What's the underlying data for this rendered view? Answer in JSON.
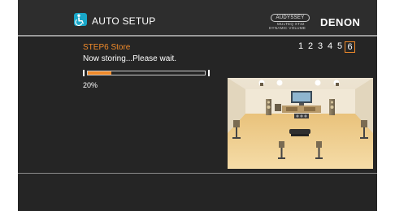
{
  "app": {
    "title": "AUTO SETUP",
    "icon": "accessibility-person-icon"
  },
  "branding": {
    "audyssey_badge": "AUDYSSEY",
    "audyssey_sub1": "MULTEQ XT32",
    "audyssey_sub2": "DYNAMIC VOLUME",
    "brand": "DENON"
  },
  "step": {
    "title": "STEP6 Store",
    "message": "Now storing...Please wait.",
    "numbers": [
      "1",
      "2",
      "3",
      "4",
      "5",
      "6"
    ],
    "active_step": 6
  },
  "progress": {
    "value": 0.2,
    "label": "20%"
  },
  "illustration": {
    "icon": "speaker-room-layout-illustration"
  },
  "colors": {
    "accent": "#f08a2a",
    "background": "#252525",
    "header": "#2d2d2d",
    "text": "#ffffff"
  }
}
